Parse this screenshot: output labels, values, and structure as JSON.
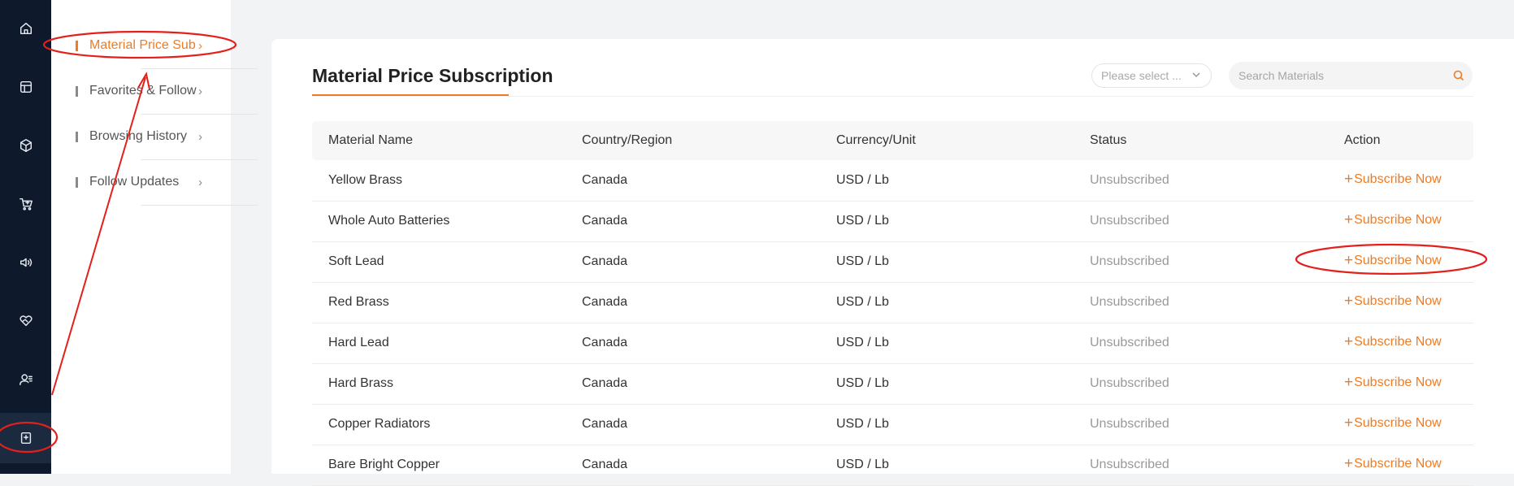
{
  "rail": {
    "icons": [
      "home-icon",
      "layout-icon",
      "cube-icon",
      "cart-icon",
      "speaker-icon",
      "heart-handshake-icon",
      "user-list-icon",
      "bookmark-plus-icon"
    ]
  },
  "submenu": {
    "items": [
      {
        "label": "Material Price Sub",
        "active": true
      },
      {
        "label": "Favorites & Follow",
        "active": false
      },
      {
        "label": "Browsing History",
        "active": false
      },
      {
        "label": "Follow Updates",
        "active": false
      }
    ]
  },
  "main": {
    "title": "Material Price Subscription",
    "select_placeholder": "Please select ...",
    "search_placeholder": "Search Materials"
  },
  "table": {
    "headers": [
      "Material Name",
      "Country/Region",
      "Currency/Unit",
      "Status",
      "Action"
    ],
    "rows": [
      {
        "name": "Yellow Brass",
        "region": "Canada",
        "unit": "USD / Lb",
        "status": "Unsubscribed",
        "action": "Subscribe Now"
      },
      {
        "name": "Whole Auto Batteries",
        "region": "Canada",
        "unit": "USD / Lb",
        "status": "Unsubscribed",
        "action": "Subscribe Now"
      },
      {
        "name": "Soft Lead",
        "region": "Canada",
        "unit": "USD / Lb",
        "status": "Unsubscribed",
        "action": "Subscribe Now"
      },
      {
        "name": "Red Brass",
        "region": "Canada",
        "unit": "USD / Lb",
        "status": "Unsubscribed",
        "action": "Subscribe Now"
      },
      {
        "name": "Hard Lead",
        "region": "Canada",
        "unit": "USD / Lb",
        "status": "Unsubscribed",
        "action": "Subscribe Now"
      },
      {
        "name": "Hard Brass",
        "region": "Canada",
        "unit": "USD / Lb",
        "status": "Unsubscribed",
        "action": "Subscribe Now"
      },
      {
        "name": "Copper Radiators",
        "region": "Canada",
        "unit": "USD / Lb",
        "status": "Unsubscribed",
        "action": "Subscribe Now"
      },
      {
        "name": "Bare Bright Copper",
        "region": "Canada",
        "unit": "USD / Lb",
        "status": "Unsubscribed",
        "action": "Subscribe Now"
      }
    ]
  },
  "colors": {
    "accent": "#f07b22",
    "rail_bg": "#0e1a2b",
    "annotation": "#e3201b"
  }
}
